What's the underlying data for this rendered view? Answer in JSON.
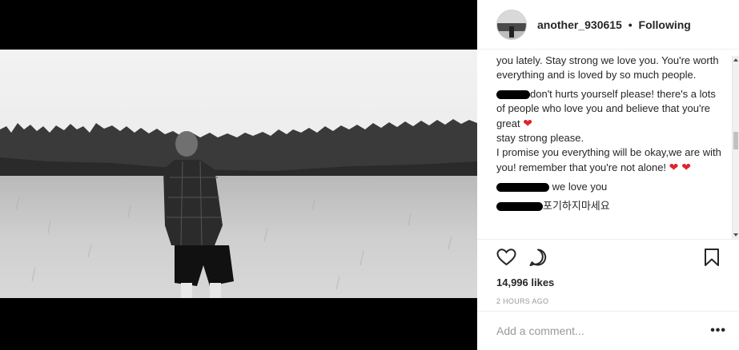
{
  "post": {
    "username": "another_930615",
    "separator": "•",
    "follow_state": "Following",
    "likes": "14,996 likes",
    "timestamp": "2 HOURS AGO"
  },
  "comments": [
    {
      "text": "you lately. Stay strong we love you. You're worth everything and is loved by so much people."
    },
    {
      "text": "don't hurts yourself please! there's a lots of people who love you and believe that you're great",
      "heart": "❤",
      "text2": "stay strong please.",
      "text3": "I promise you everything will be okay,we are with you! remember that you're not alone!",
      "hearts2": "❤ ❤"
    },
    {
      "text": "we love you"
    },
    {
      "text": "포기하지마세요"
    }
  ],
  "add_comment": {
    "placeholder": "Add a comment...",
    "more_label": "•••"
  },
  "icons": {
    "like": "heart-outline-icon",
    "comment": "comment-bubble-icon",
    "save": "bookmark-icon"
  },
  "colors": {
    "accent_heart": "#e0232e",
    "text": "#262626",
    "muted": "#999999"
  }
}
